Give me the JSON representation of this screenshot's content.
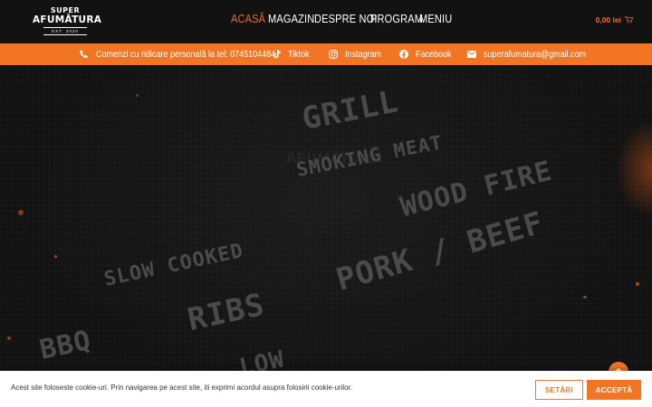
{
  "logo": {
    "line1": "SUPER",
    "line2": "AFUMĂTURA",
    "line3": "EST. 2020"
  },
  "nav": {
    "items": [
      "ACASĂ",
      "MAGAZIN",
      "DESPRE NOI",
      "PROGRAM",
      "MENIU"
    ],
    "active": "ACASĂ"
  },
  "cart": {
    "amount": "0,00 lei",
    "icon": "cart-icon"
  },
  "topbar": {
    "phone": {
      "icon": "phone-icon",
      "text": "Comenzi cu ridicare personală la tel: 0745104484"
    },
    "tiktok": {
      "icon": "tiktok-icon",
      "text": "Tiktok"
    },
    "instagram": {
      "icon": "instagram-icon",
      "text": "Instagram"
    },
    "facebook": {
      "icon": "facebook-icon",
      "text": "Facebook"
    },
    "email": {
      "icon": "envelope-icon",
      "text": "superafumatura@gmail.com"
    }
  },
  "hero": {
    "words": [
      "GRILL",
      "SMOKING MEAT",
      "WOOD FIRE",
      "SLOW COOKED",
      "PORK / BEEF",
      "RIBS",
      "BBQ",
      "LOW"
    ],
    "ghost_text": [
      "AFUMĂTURA"
    ]
  },
  "cookie": {
    "text": "Acest site foloseste cookie-uri. Prin navigarea pe acest site, iti exprimi acordul asupra folosirii cookie-urilor.",
    "settings_label": "SETĂRI",
    "accept_label": "ACCEPTĂ"
  },
  "scroll_top": {
    "icon": "chevron-up-icon"
  },
  "colors": {
    "accent": "#f27524",
    "header_bg": "#121212",
    "hero_bg": "#141414",
    "stencil": "#4a4a4a"
  }
}
